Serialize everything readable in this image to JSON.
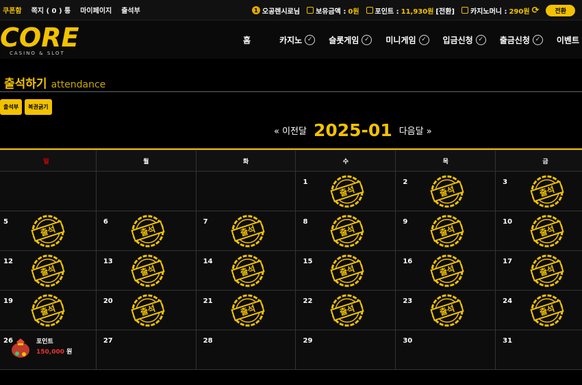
{
  "topbar": {
    "links": [
      "쿠폰함",
      "쪽지 ( 0 ) 통",
      "마이페이지",
      "출석부"
    ],
    "username": "오공렌시로님",
    "level_badge": "1",
    "holding_label": "보유금액 :",
    "holding_value": "0원",
    "points_label": "포인트 :",
    "points_value": "11,930원",
    "points_convert": "[전환]",
    "casino_label": "카지노머니 :",
    "casino_value": "290원",
    "switch_label": "전환"
  },
  "logo": {
    "main": "CORE",
    "sub": "CASINO & SLOT"
  },
  "nav": {
    "home": "홈",
    "items": [
      "카지노",
      "슬롯게임",
      "미니게임",
      "입금신청",
      "출금신청",
      "이벤트"
    ]
  },
  "page": {
    "title": "출석하기",
    "title_en": "attendance"
  },
  "buttons": {
    "attendance_book": "출석부",
    "lottery": "복권긁기"
  },
  "month_nav": {
    "prev": "« 이전달",
    "current": "2025-01",
    "next": "다음달 »"
  },
  "calendar": {
    "weekdays": [
      "일",
      "월",
      "화",
      "수",
      "목",
      "금"
    ],
    "stamp_text": "출석",
    "rows": [
      [
        "",
        "",
        "",
        "1",
        "2",
        "3"
      ],
      [
        "5",
        "6",
        "7",
        "8",
        "9",
        "10"
      ],
      [
        "12",
        "13",
        "14",
        "15",
        "16",
        "17"
      ],
      [
        "19",
        "20",
        "21",
        "22",
        "23",
        "24"
      ],
      [
        "26",
        "27",
        "28",
        "29",
        "30",
        "31"
      ]
    ],
    "reward": {
      "label": "포인트",
      "amount": "150,000",
      "unit": "원"
    }
  },
  "colors": {
    "accent": "#f2c200",
    "sunday": "#e00000",
    "background": "#000000"
  }
}
